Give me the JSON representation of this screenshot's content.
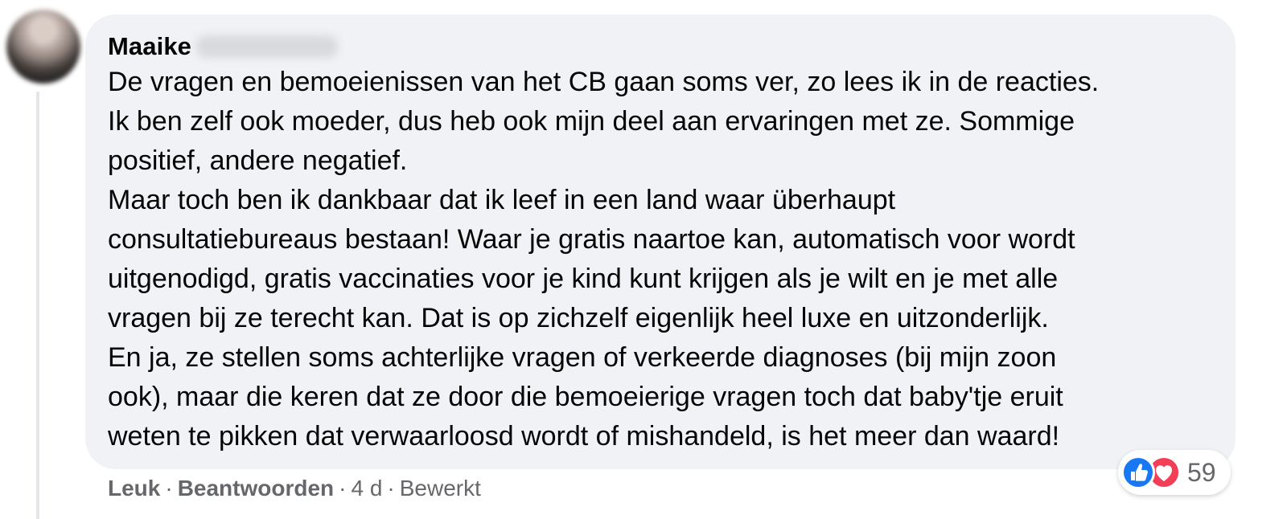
{
  "comment": {
    "author_first_name": "Maaike",
    "text_lines": [
      "De vragen en bemoeienissen van het CB gaan soms ver, zo lees ik in de reacties.",
      "Ik ben zelf ook moeder, dus heb ook mijn deel aan ervaringen met ze. Sommige",
      "positief, andere negatief.",
      "Maar toch ben ik dankbaar dat ik leef in een land waar überhaupt",
      "consultatiebureaus bestaan! Waar je gratis naartoe kan, automatisch voor wordt",
      "uitgenodigd, gratis vaccinaties voor je kind kunt krijgen als je wilt en je met alle",
      "vragen bij ze terecht kan. Dat is op zichzelf eigenlijk heel luxe en uitzonderlijk.",
      "En ja, ze stellen soms achterlijke vragen of verkeerde diagnoses (bij mijn zoon",
      "ook), maar die keren dat ze door die bemoeierige vragen toch dat baby'tje eruit",
      "weten te pikken dat verwaarloosd wordt of mishandeld, is het meer dan waard!"
    ],
    "reactions": {
      "icons": [
        "like-icon",
        "love-icon"
      ],
      "count": "59"
    },
    "actions": {
      "like_label": "Leuk",
      "reply_label": "Beantwoorden",
      "separator": "·",
      "age": "4 d",
      "edited_label": "Bewerkt"
    }
  },
  "colors": {
    "bubble_background": "#f0f2f5",
    "text": "#050505",
    "secondary_text": "#65676b",
    "like_blue": "#1877f2",
    "love_red": "#f33e58"
  }
}
